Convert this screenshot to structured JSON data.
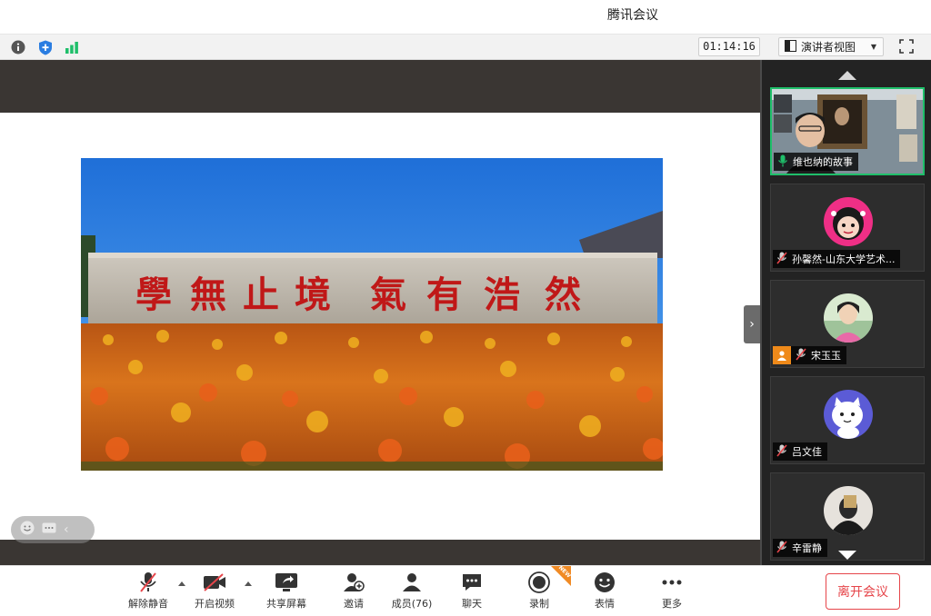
{
  "window": {
    "title": "腾讯会议"
  },
  "toolbar": {
    "timer": "01:14:16",
    "view_label": "演讲者视图",
    "icons": [
      "info-icon",
      "shield-icon",
      "signal-icon",
      "layout-icon",
      "fullscreen-icon"
    ]
  },
  "participants": [
    {
      "name": "维也纳的故事",
      "active": true,
      "mic": "on"
    },
    {
      "name": "孙馨然-山东大学艺术...",
      "active": false,
      "mic": "muted"
    },
    {
      "name": "宋玉玉",
      "active": false,
      "mic": "muted",
      "host": true
    },
    {
      "name": "吕文佳",
      "active": false,
      "mic": "muted"
    },
    {
      "name": "辛雷静",
      "active": false,
      "mic": "muted"
    }
  ],
  "controls": {
    "unmute": "解除静音",
    "video": "开启视频",
    "share": "共享屏幕",
    "invite": "邀请",
    "members": "成员(76)",
    "chat": "聊天",
    "record": "录制",
    "emoji": "表情",
    "more": "更多",
    "new_badge": "NEW"
  },
  "leave_label": "离开会议",
  "colors": {
    "active_border": "#1fbf6a",
    "leave_red": "#e6454a",
    "host_orange": "#ef8a1a",
    "new_badge": "#f08a24"
  }
}
